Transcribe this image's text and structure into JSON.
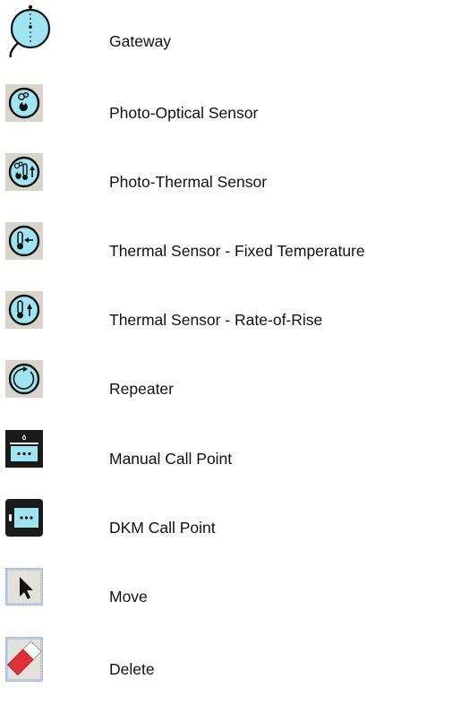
{
  "legend": {
    "items": [
      {
        "icon": "gateway-icon",
        "label": "Gateway"
      },
      {
        "icon": "photo-optical-sensor-icon",
        "label": "Photo-Optical Sensor"
      },
      {
        "icon": "photo-thermal-sensor-icon",
        "label": "Photo-Thermal Sensor"
      },
      {
        "icon": "thermal-fixed-temperature-icon",
        "label": "Thermal Sensor - Fixed Temperature"
      },
      {
        "icon": "thermal-rate-of-rise-icon",
        "label": "Thermal Sensor - Rate-of-Rise"
      },
      {
        "icon": "repeater-icon",
        "label": "Repeater"
      },
      {
        "icon": "manual-call-point-icon",
        "label": "Manual Call Point"
      },
      {
        "icon": "dkm-call-point-icon",
        "label": "DKM Call Point"
      },
      {
        "icon": "move-arrow-icon",
        "label": "Move"
      },
      {
        "icon": "delete-eraser-icon",
        "label": "Delete"
      }
    ]
  },
  "colors": {
    "sensor_fill": "#9fe4f0",
    "tile_bg": "#d8d4cc",
    "dark_tile": "#1a1a1a",
    "selection_border": "#7fa4d8",
    "eraser_red": "#e0303a"
  }
}
